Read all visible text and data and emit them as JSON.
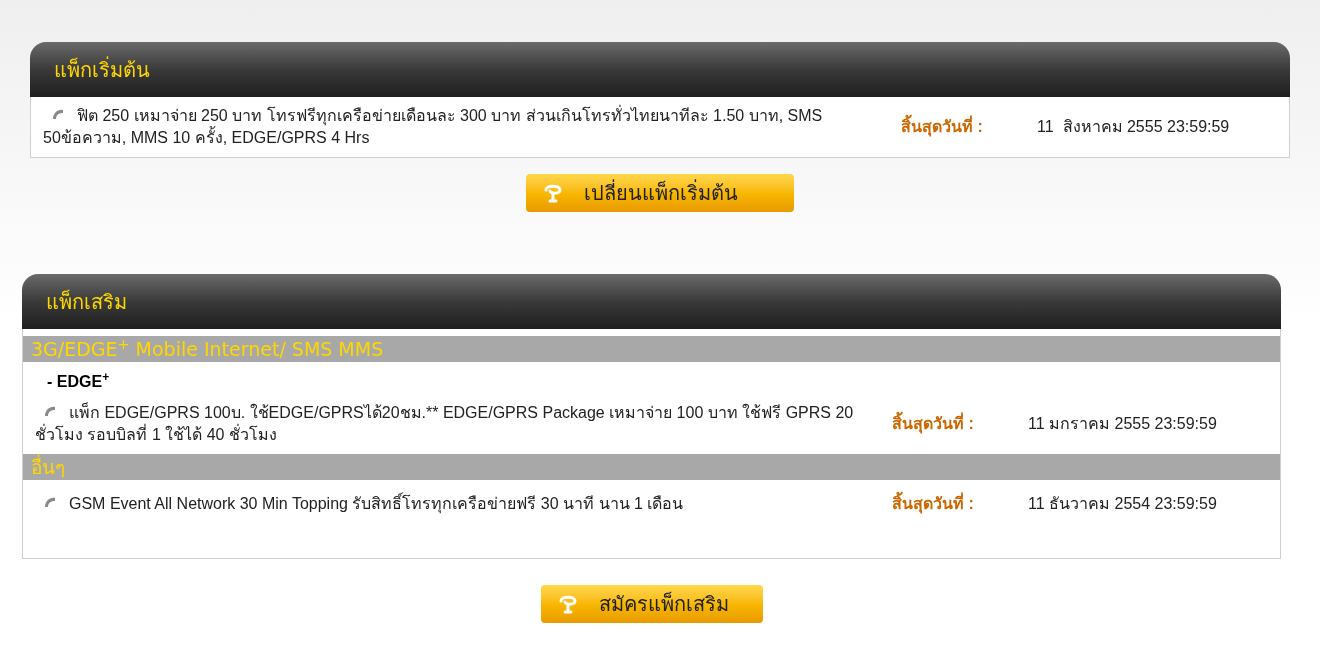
{
  "main_package": {
    "title": "แพ็กเริ่มต้น",
    "items": [
      {
        "description": "ฟิต 250 เหมาจ่าย 250 บาท โทรฟรีทุกเครือข่ายเดือนละ 300 บาท ส่วนเกินโทรทั่วไทยนาทีละ 1.50 บาท, SMS 50ข้อความ, MMS 10 ครั้ง, EDGE/GPRS 4 Hrs",
        "expiry_label": "สิ้นสุดวันที่ :",
        "expiry": "11  สิงหาคม 2555 23:59:59"
      }
    ],
    "button": "เปลี่ยนแพ็กเริ่มต้น"
  },
  "addon_package": {
    "title": "แพ็กเสริม",
    "categories": [
      {
        "title": "3G/EDGE$^{+}$ Mobile Internet/ SMS MMS",
        "subheading": "- EDGE$^{+}$",
        "items": [
          {
            "description": "แพ็ก EDGE/GPRS 100บ. ใช้EDGE/GPRSได้20ชม.** EDGE/GPRS Package เหมาจ่าย 100 บาท ใช้ฟรี GPRS 20 ชั่วโมง รอบบิลที่ 1 ใช้ได้ 40 ชั่วโมง",
            "expiry_label": "สิ้นสุดวันที่ :",
            "expiry": "11 มกราคม 2555 23:59:59"
          }
        ]
      },
      {
        "title": "อื่นๆ",
        "items": [
          {
            "description": "GSM Event All Network 30 Min Topping รับสิทธิ์โทรทุกเครือข่ายฟรี 30 นาที นาน 1  เดือน",
            "expiry_label": "สิ้นสุดวันที่ :",
            "expiry": "11 ธันวาคม 2554 23:59:59"
          }
        ]
      }
    ],
    "button": "สมัครแพ็กเสริม"
  }
}
